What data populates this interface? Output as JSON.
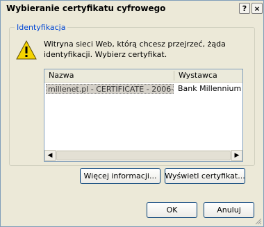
{
  "window": {
    "title": "Wybieranie certyfikatu cyfrowego",
    "help_glyph": "?",
    "close_glyph": "×"
  },
  "group": {
    "label": "Identyfikacja",
    "message": "Witryna sieci Web, którą chcesz przejrzeć, żąda identyfikacji. Wybierz certyfikat."
  },
  "list": {
    "columns": [
      "Nazwa",
      "Wystawca"
    ],
    "rows": [
      {
        "name": "millenet.pl - CERTIFICATE - 2006-...",
        "issuer": "Bank Millennium"
      }
    ]
  },
  "buttons": {
    "info_label": "Więcej informacji...",
    "view_label": "Wyświetl certyfikat...",
    "ok_label": "OK",
    "cancel_label": "Anuluj"
  },
  "colors": {
    "group_label": "#0046d5",
    "warning": "#f5d400"
  }
}
